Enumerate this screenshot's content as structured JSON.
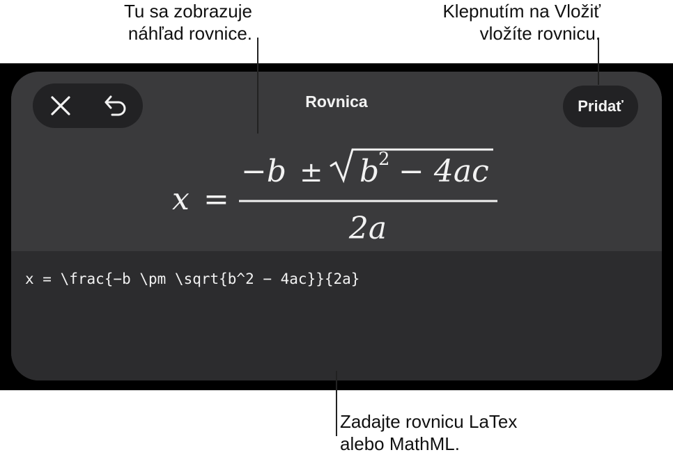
{
  "callouts": {
    "preview": [
      "Tu sa zobrazuje",
      "náhľad rovnice."
    ],
    "insert": [
      "Klepnutím na Vložiť",
      "vložíte rovnicu."
    ],
    "input": [
      "Zadajte rovnicu LaTex",
      "alebo MathML."
    ]
  },
  "header": {
    "title": "Rovnica",
    "add_label": "Pridať"
  },
  "icons": {
    "close": "close-icon",
    "undo": "undo-icon"
  },
  "equation": {
    "lhs": "x",
    "equals": "=",
    "num_minus_b": "−b",
    "pm": "±",
    "radicand_b": "b",
    "exponent": "2",
    "radicand_rest": "− 4ac",
    "denominator": "2a"
  },
  "latex_input": {
    "value": "x = \\frac{−b \\pm \\sqrt{b^2 − 4ac}}{2a}"
  },
  "colors": {
    "sheet": "#2c2c2e",
    "preview_bg": "#3a3a3c",
    "button_bg": "#222224",
    "text": "#f2f2f2"
  }
}
